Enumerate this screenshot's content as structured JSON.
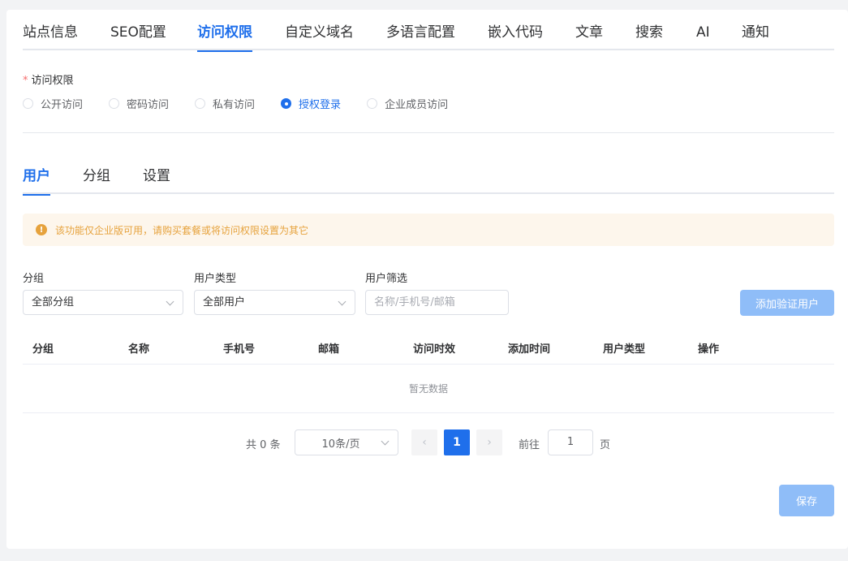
{
  "tabs": [
    "站点信息",
    "SEO配置",
    "访问权限",
    "自定义域名",
    "多语言配置",
    "嵌入代码",
    "文章",
    "搜索",
    "AI",
    "通知"
  ],
  "access": {
    "label": "访问权限",
    "required_mark": "*",
    "options": [
      "公开访问",
      "密码访问",
      "私有访问",
      "授权登录",
      "企业成员访问"
    ],
    "selected": "授权登录"
  },
  "sub_tabs": [
    "用户",
    "分组",
    "设置"
  ],
  "alert": {
    "icon": "warning-icon",
    "text": "该功能仅企业版可用，请购买套餐或将访问权限设置为其它"
  },
  "filters": {
    "group_label": "分组",
    "group_value": "全部分组",
    "type_label": "用户类型",
    "type_value": "全部用户",
    "search_label": "用户筛选",
    "search_placeholder": "名称/手机号/邮箱",
    "add_button": "添加验证用户"
  },
  "table": {
    "columns": [
      "分组",
      "名称",
      "手机号",
      "邮箱",
      "访问时效",
      "添加时间",
      "用户类型",
      "操作"
    ],
    "empty_text": "暂无数据"
  },
  "pagination": {
    "total_text": "共 0 条",
    "page_size": "10条/页",
    "prev": "‹",
    "current": "1",
    "next": "›",
    "goto_label": "前往",
    "goto_value": "1",
    "page_suffix": "页"
  },
  "save_button": "保存",
  "colors": {
    "primary": "#1f6feb",
    "disabled_primary": "#8fbdf8",
    "warning": "#e6a23c"
  }
}
